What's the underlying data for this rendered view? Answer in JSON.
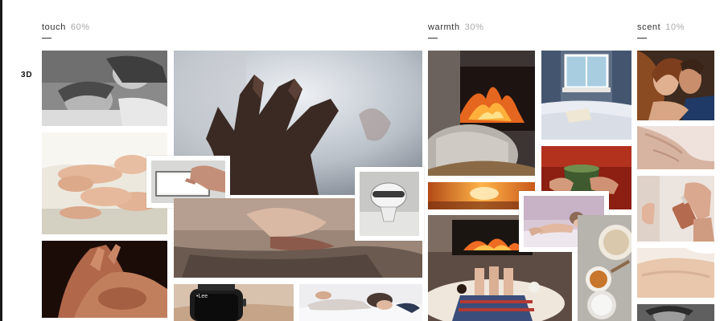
{
  "columns": [
    {
      "name": "touch",
      "percent": "60%"
    },
    {
      "name": "warmth",
      "percent": "30%"
    },
    {
      "name": "scent",
      "percent": "10%"
    }
  ],
  "row_label": "3D",
  "watch_screen_text": "•Lee",
  "photos": [
    {
      "id": "touch-couple-bw",
      "subject": "couple resting together (black and white)"
    },
    {
      "id": "touch-feet",
      "subject": "intertwined feet on bed sheets"
    },
    {
      "id": "touch-hands",
      "subject": "hands holding on dark background"
    },
    {
      "id": "touch-reaching-hand",
      "subject": "hand reaching toward light"
    },
    {
      "id": "touch-tablet",
      "subject": "fingers touching tablet screen"
    },
    {
      "id": "touch-kiss",
      "subject": "close-up kiss"
    },
    {
      "id": "touch-device",
      "subject": "small white smart device"
    },
    {
      "id": "touch-watch",
      "subject": "smartwatch on wrist"
    },
    {
      "id": "touch-bed",
      "subject": "person lying on white bed"
    },
    {
      "id": "warmth-fireplace",
      "subject": "fireplace with knitted blanket"
    },
    {
      "id": "warmth-window",
      "subject": "bed by window with book"
    },
    {
      "id": "warmth-mug",
      "subject": "hands holding warm mug"
    },
    {
      "id": "warmth-sunset",
      "subject": "warm sunset light"
    },
    {
      "id": "warmth-woman",
      "subject": "woman lying in soft light"
    },
    {
      "id": "warmth-feet-fire",
      "subject": "feet in socks by the fire"
    },
    {
      "id": "warmth-food",
      "subject": "bowls of spices and ingredients"
    },
    {
      "id": "scent-couple",
      "subject": "couple embracing"
    },
    {
      "id": "scent-neck",
      "subject": "close-up of neck"
    },
    {
      "id": "scent-perfume",
      "subject": "hand holding perfume bottle"
    },
    {
      "id": "scent-skin",
      "subject": "bare shoulder"
    },
    {
      "id": "scent-man",
      "subject": "man's face"
    }
  ]
}
